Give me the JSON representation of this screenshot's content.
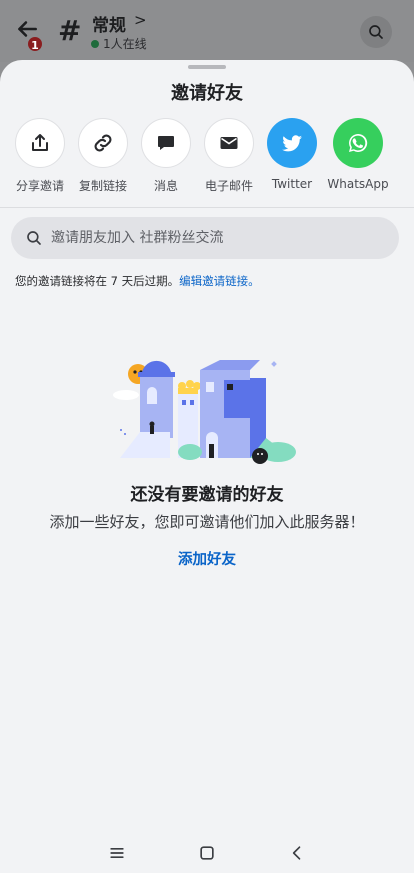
{
  "header": {
    "badge_count": "1",
    "channel_hash": "#",
    "channel_name": "常规",
    "channel_chevron": ">",
    "online_text": "1人在线"
  },
  "sheet": {
    "title": "邀请好友",
    "share_options": [
      {
        "label": "分享邀请",
        "icon": "share-upload-icon"
      },
      {
        "label": "复制链接",
        "icon": "link-icon"
      },
      {
        "label": "消息",
        "icon": "message-bubble-icon"
      },
      {
        "label": "电子邮件",
        "icon": "envelope-icon"
      },
      {
        "label": "Twitter",
        "icon": "twitter-bird-icon"
      },
      {
        "label": "WhatsApp",
        "icon": "whatsapp-icon"
      }
    ],
    "search_placeholder": "邀请朋友加入 社群粉丝交流",
    "expire_text": "您的邀请链接将在 7 天后过期。",
    "edit_link": "编辑邀请链接。",
    "empty_title": "还没有要邀请的好友",
    "empty_subtitle": "添加一些好友，您即可邀请他们加入此服务器！",
    "add_friends": "添加好友"
  },
  "colors": {
    "accent_blue": "#0a64c8",
    "twitter_blue": "#2aa1f0",
    "whatsapp_green": "#36cf5d",
    "badge_red": "#8a1d1f"
  }
}
